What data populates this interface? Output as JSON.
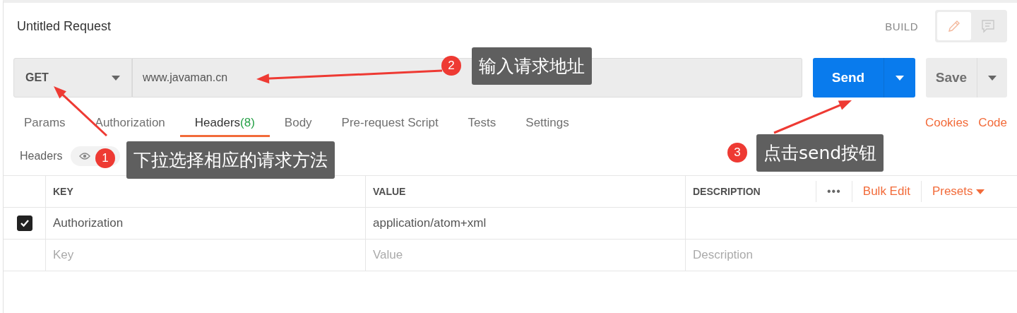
{
  "title": "Untitled Request",
  "mode_label": "BUILD",
  "mode_buttons": [
    {
      "kind": "pencil",
      "selected": true
    },
    {
      "kind": "comment",
      "selected": false
    }
  ],
  "request": {
    "method": "GET",
    "url": "www.javaman.cn",
    "send": "Send",
    "save": "Save"
  },
  "tabs": [
    {
      "label": "Params",
      "selected": false
    },
    {
      "label": "Authorization",
      "selected": false
    },
    {
      "label": "Headers",
      "count": "(8)",
      "selected": true
    },
    {
      "label": "Body",
      "selected": false
    },
    {
      "label": "Pre-request Script",
      "selected": false
    },
    {
      "label": "Tests",
      "selected": false
    },
    {
      "label": "Settings",
      "selected": false
    }
  ],
  "links": [
    "Cookies",
    "Code"
  ],
  "headers_bar": {
    "label": "Headers"
  },
  "table": {
    "columns": [
      "KEY",
      "VALUE",
      "DESCRIPTION"
    ],
    "more": "•••",
    "bulk_edit": "Bulk Edit",
    "presets": "Presets",
    "rows": [
      {
        "checked": true,
        "key": "Authorization",
        "value": "application/atom+xml"
      }
    ],
    "new_row": [
      {
        "placeholder": "Key"
      },
      {
        "placeholder": "Value"
      },
      {
        "placeholder": "Description"
      }
    ]
  },
  "annotations": [
    {
      "number": "1",
      "text": "下拉选择相应的请求方法"
    },
    {
      "number": "2",
      "text": "输入请求地址"
    },
    {
      "number": "3",
      "text": "点击send按钮"
    }
  ]
}
